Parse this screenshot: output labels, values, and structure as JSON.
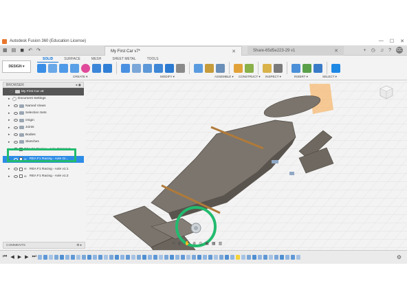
{
  "window": {
    "title": "Autodesk Fusion 360 (Education License)",
    "controls": [
      "—",
      "☐",
      "✕"
    ]
  },
  "tabs": {
    "active": {
      "label": "My First Car v7*"
    },
    "second": {
      "label": "Share-65d5e223-29 v1"
    }
  },
  "avatar_initials": "CC",
  "toolbar": {
    "design_label": "DESIGN ▾",
    "workspace_tabs": [
      "SOLID",
      "SURFACE",
      "MESH",
      "SHEET METAL",
      "TOOLS"
    ],
    "groups": [
      "CREATE ▾",
      "MODIFY ▾",
      "ASSEMBLE ▾",
      "CONSTRUCT ▾",
      "INSPECT ▾",
      "INSERT ▾",
      "SELECT ▾"
    ]
  },
  "browser": {
    "header": "BROWSER",
    "root": "My First Car v8",
    "items": [
      {
        "label": "Document Settings",
        "icon": "gear-icon"
      },
      {
        "label": "Named Views",
        "icon": "folder-icon"
      },
      {
        "label": "Selection Sets",
        "icon": "folder-icon"
      },
      {
        "label": "Origin",
        "icon": "folder-icon"
      },
      {
        "label": "Joints",
        "icon": "folder-icon"
      },
      {
        "label": "Bodies",
        "icon": "folder-icon"
      },
      {
        "label": "Sketches",
        "icon": "folder-icon"
      },
      {
        "label": "REA F1 Racing - Axle Grommet",
        "icon": "component-icon"
      },
      {
        "label": "REA F1 Racing - Axle Gr...",
        "icon": "link-icon",
        "selected": true
      },
      {
        "label": "REA F1 Racing - Axle v1:1",
        "icon": "link-icon"
      },
      {
        "label": "REA F1 Racing - Axle v1:2",
        "icon": "link-icon"
      }
    ]
  },
  "comments": {
    "label": "COMMENTS"
  },
  "colors": {
    "accent": "#0a6fd6",
    "highlight": "#22bb6e",
    "selection": "#2d8ce6",
    "body": "#6e6860",
    "axle": "#b07a3a"
  }
}
